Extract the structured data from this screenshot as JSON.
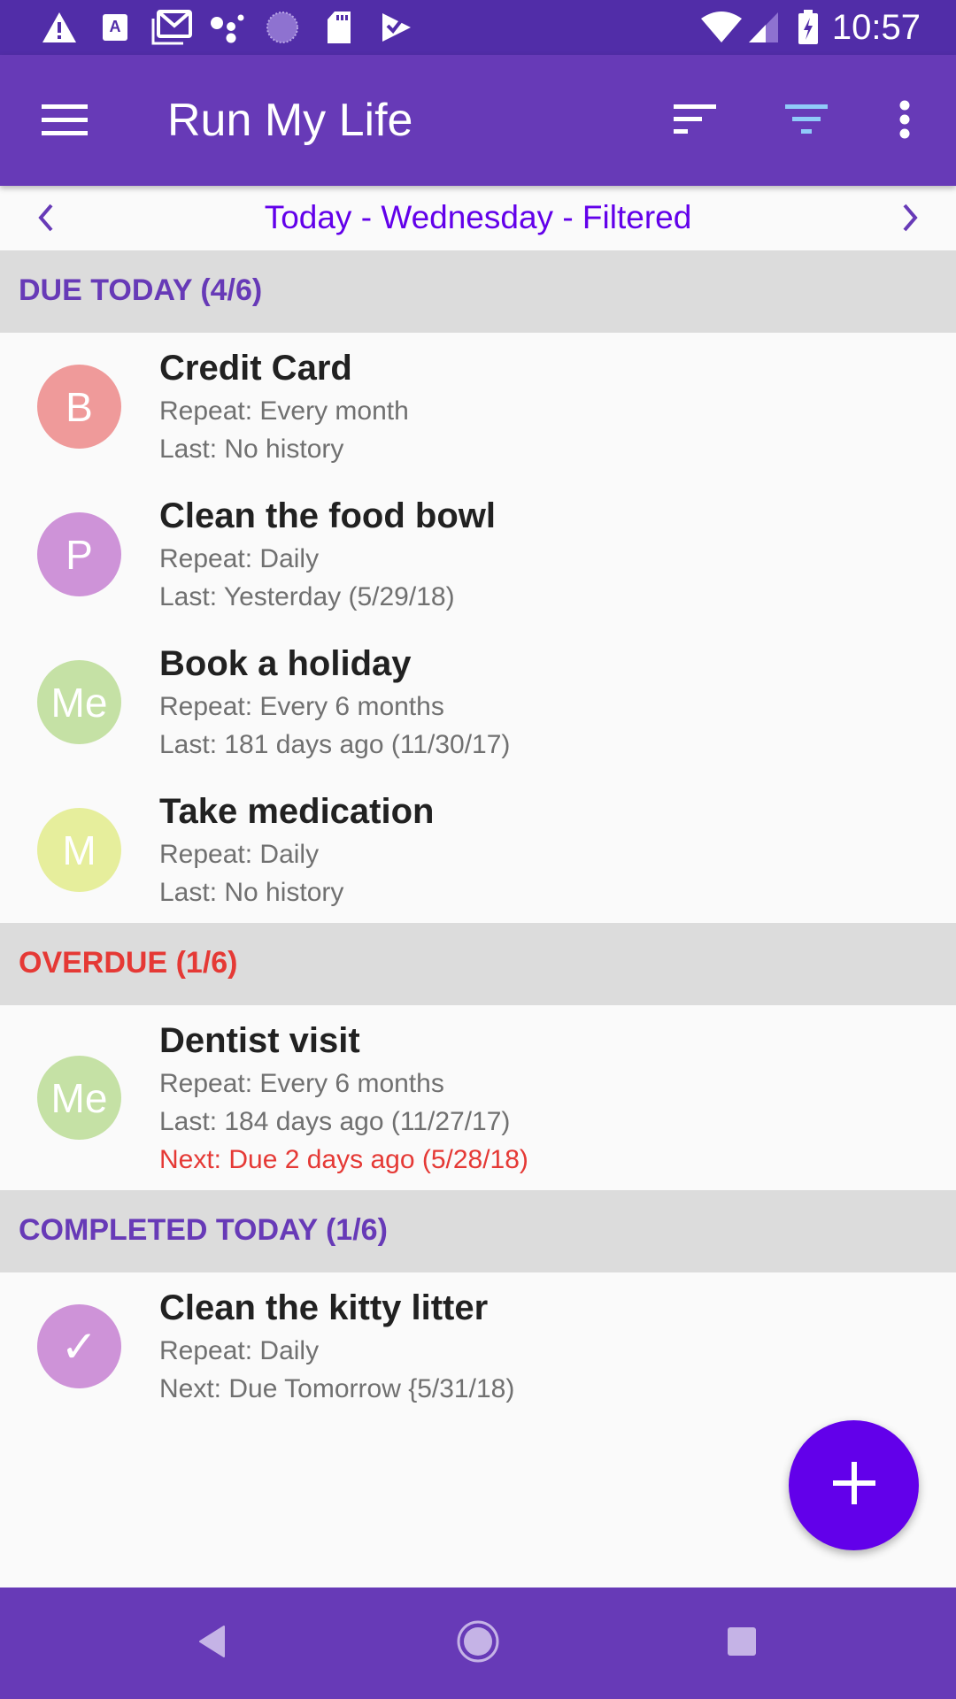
{
  "status_bar": {
    "time": "10:57",
    "left_icons": [
      "warning-icon",
      "accessibility-a-icon",
      "gmail-icon",
      "assistant-dots-icon",
      "sync-circle-icon",
      "sd-card-icon",
      "tasks-check-icon"
    ],
    "right_icons": [
      "wifi-icon",
      "cell-signal-icon",
      "battery-charging-icon"
    ]
  },
  "app_bar": {
    "title": "Run My Life",
    "menu_icon": "hamburger-menu-icon",
    "sort_icon": "sort-icon",
    "filter_icon": "filter-icon",
    "more_icon": "more-vert-icon",
    "filter_active_color": "#90caf9"
  },
  "date_bar": {
    "label": "Today - Wednesday - Filtered",
    "prev_icon": "chevron-left-icon",
    "next_icon": "chevron-right-icon"
  },
  "colors": {
    "status_bar": "#512da8",
    "primary": "#673ab7",
    "accent": "#6200ea",
    "section_purple": "#673ab7",
    "section_red": "#e53935",
    "overdue_text": "#e53935"
  },
  "sections": [
    {
      "header": "DUE TODAY (4/6)",
      "color": "#673ab7",
      "tasks": [
        {
          "initial": "B",
          "avatar_color": "#ef9a9a",
          "title": "Credit Card",
          "lines": [
            "Repeat: Every month",
            "Last: No history"
          ]
        },
        {
          "initial": "P",
          "avatar_color": "#ce93d8",
          "title": "Clean the food bowl",
          "lines": [
            "Repeat: Daily",
            "Last: Yesterday (5/29/18)"
          ]
        },
        {
          "initial": "Me",
          "avatar_color": "#c5e1a5",
          "title": "Book a holiday",
          "lines": [
            "Repeat: Every 6 months",
            "Last: 181 days ago (11/30/17)"
          ]
        },
        {
          "initial": "M",
          "avatar_color": "#e6ee9c",
          "title": "Take medication",
          "lines": [
            "Repeat: Daily",
            "Last: No history"
          ]
        }
      ]
    },
    {
      "header": "OVERDUE (1/6)",
      "color": "#e53935",
      "tasks": [
        {
          "initial": "Me",
          "avatar_color": "#c5e1a5",
          "title": "Dentist visit",
          "lines": [
            "Repeat: Every 6 months",
            "Last: 184 days ago (11/27/17)"
          ],
          "overdue_line": "Next: Due 2 days ago (5/28/18)"
        }
      ]
    },
    {
      "header": "COMPLETED TODAY (1/6)",
      "color": "#673ab7",
      "tasks": [
        {
          "initial": "✓",
          "avatar_color": "#ce93d8",
          "title": "Clean the kitty litter",
          "lines": [
            "Repeat: Daily",
            "Next: Due Tomorrow {5/31/18)"
          ]
        }
      ]
    }
  ],
  "fab": {
    "icon": "plus-icon",
    "label": "+"
  },
  "nav_bar": {
    "back_icon": "back-triangle-icon",
    "home_icon": "home-circle-icon",
    "recents_icon": "recents-square-icon"
  }
}
